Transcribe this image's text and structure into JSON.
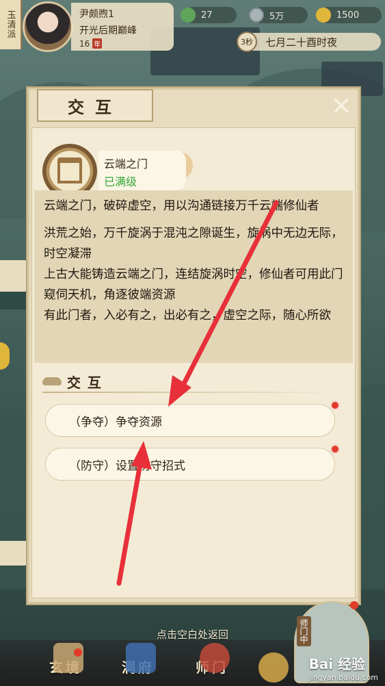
{
  "sect": "玉清派",
  "player": {
    "name": "尹颇煦1",
    "realm": "开光后期巅峰",
    "age": "16",
    "age_seal": "年"
  },
  "resources": [
    {
      "name": "leaf-currency",
      "value": "27"
    },
    {
      "name": "silver-coin",
      "value": "5万"
    },
    {
      "name": "gold-ingot",
      "value": "1500"
    }
  ],
  "time": {
    "counter": "3秒",
    "label": "七月二十酉时夜"
  },
  "dialog": {
    "title": "交互",
    "close_icon": "close-icon",
    "building": {
      "name": "云端之门",
      "status": "已满级",
      "status_color": "#38a838"
    },
    "description": [
      "云端之门，破碎虚空，用以沟通链接万千云端修仙者",
      "洪荒之始，万千旋涡于混沌之隙诞生，旋涡中无边无际，时空凝滞",
      "上古大能铸造云端之门，连结旋涡时空，修仙者可用此门窥伺天机，角逐彼端资源",
      "有此门者，入必有之，出必有之，虚空之际，随心所欲"
    ],
    "section_title": "交互",
    "actions": [
      {
        "label": "（争夺）争夺资源",
        "has_notification": true
      },
      {
        "label": "（防守）设置防守招式",
        "has_notification": true
      }
    ]
  },
  "back_hint": "点击空白处返回",
  "bottom_nav": [
    {
      "label": "玄境"
    },
    {
      "label": "洞府"
    },
    {
      "label": "师门"
    }
  ],
  "master_label": "师门中",
  "watermark": {
    "brand": "Bai 经验",
    "url": "jingyan.baidu.com"
  },
  "colors": {
    "accent_red": "#e23b2b",
    "maxed_green": "#38a838"
  }
}
